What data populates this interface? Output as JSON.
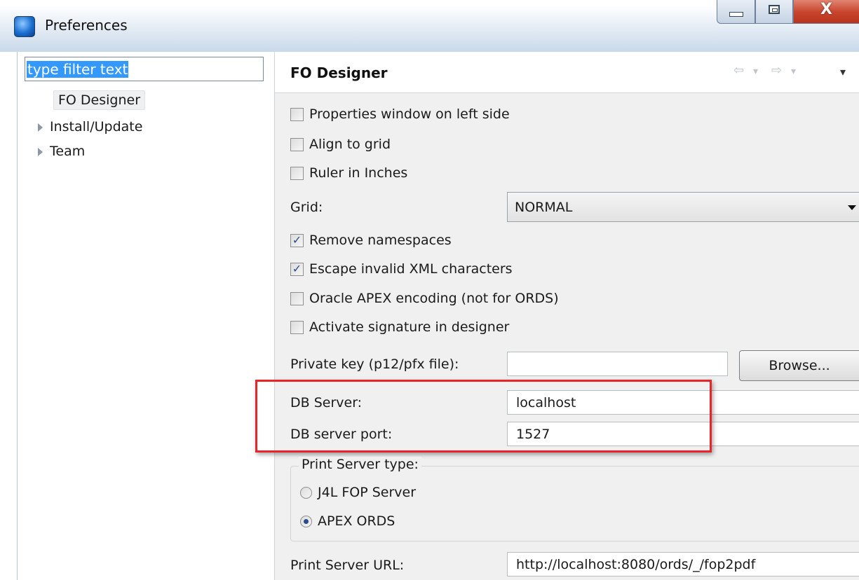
{
  "window": {
    "title": "Preferences",
    "controls": {
      "minimize": "minimize",
      "maximize": "maximize",
      "close": "X"
    }
  },
  "sidebar": {
    "filter_placeholder": "type filter text",
    "filter_value": "type filter text",
    "items": [
      {
        "label": "FO Designer",
        "selected": true,
        "expandable": false
      },
      {
        "label": "Install/Update",
        "selected": false,
        "expandable": true
      },
      {
        "label": "Team",
        "selected": false,
        "expandable": true
      }
    ]
  },
  "page": {
    "title": "FO Designer",
    "nav": {
      "back": "⇦",
      "forward": "⇨",
      "menu": "▾"
    },
    "checkboxes": [
      {
        "label": "Properties window on left side",
        "checked": false
      },
      {
        "label": "Align to grid",
        "checked": false
      },
      {
        "label": "Ruler in Inches",
        "checked": false
      },
      {
        "label": "Remove namespaces",
        "checked": true
      },
      {
        "label": "Escape invalid XML characters",
        "checked": true
      },
      {
        "label": "Oracle APEX encoding (not for ORDS)",
        "checked": false
      },
      {
        "label": "Activate signature in designer",
        "checked": false
      }
    ],
    "grid": {
      "label": "Grid:",
      "value": "NORMAL"
    },
    "private_key": {
      "label": "Private key (p12/pfx file):",
      "value": "",
      "browse_label": "Browse..."
    },
    "db_server": {
      "label": "DB Server:",
      "value": "localhost"
    },
    "db_port": {
      "label": "DB server port:",
      "value": "1527"
    },
    "print_server_type": {
      "label": "Print Server type:",
      "options": [
        {
          "label": "J4L FOP Server",
          "checked": false
        },
        {
          "label": "APEX ORDS",
          "checked": true
        }
      ]
    },
    "print_server_url": {
      "label": "Print Server URL:",
      "value": "http://localhost:8080/ords/_/fop2pdf"
    }
  },
  "colors": {
    "highlight": "#e8262a",
    "selection": "#3399ff",
    "check": "#2a4d8a"
  }
}
